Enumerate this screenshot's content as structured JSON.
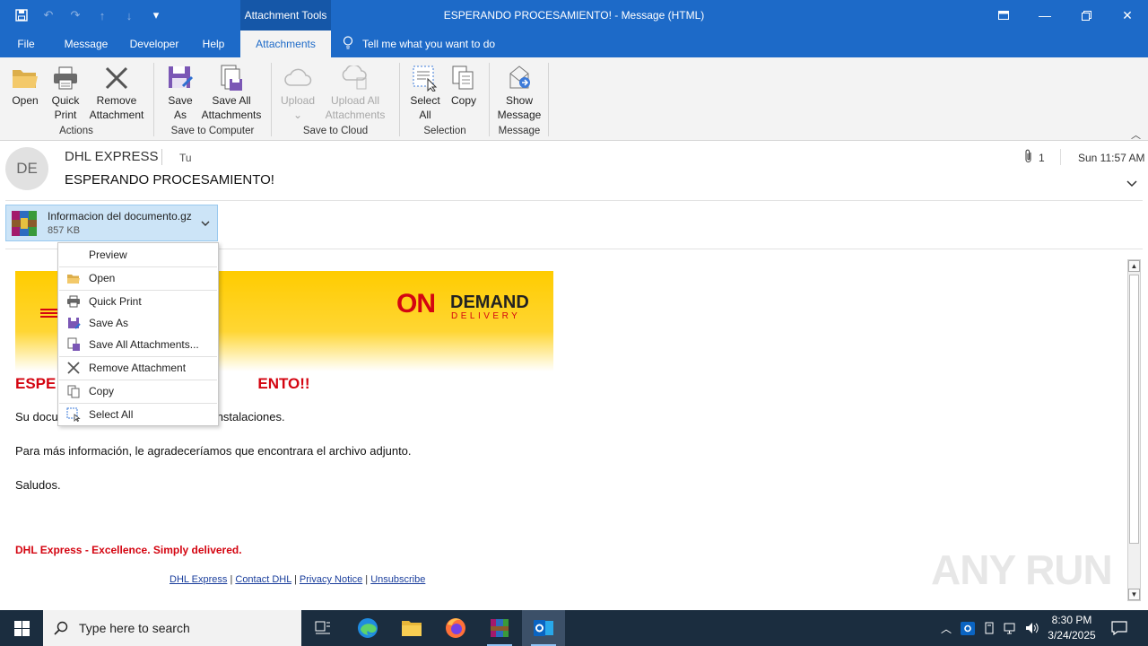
{
  "window": {
    "context_tab_group": "Attachment Tools",
    "title": "ESPERANDO PROCESAMIENTO!  -  Message (HTML)"
  },
  "tabs": [
    {
      "label": "File"
    },
    {
      "label": "Message"
    },
    {
      "label": "Developer"
    },
    {
      "label": "Help"
    },
    {
      "label": "Attachments"
    }
  ],
  "tell_me": "Tell me what you want to do",
  "ribbon": {
    "open": "Open",
    "quick_print_1": "Quick",
    "quick_print_2": "Print",
    "remove_1": "Remove",
    "remove_2": "Attachment",
    "group_actions": "Actions",
    "save_as_1": "Save",
    "save_as_2": "As",
    "save_all_1": "Save All",
    "save_all_2": "Attachments",
    "group_save": "Save to Computer",
    "upload": "Upload",
    "upload_all_1": "Upload All",
    "upload_all_2": "Attachments",
    "group_cloud": "Save to Cloud",
    "select_all_1": "Select",
    "select_all_2": "All",
    "copy": "Copy",
    "group_selection": "Selection",
    "show_msg_1": "Show",
    "show_msg_2": "Message",
    "group_message": "Message"
  },
  "message": {
    "avatar_initials": "DE",
    "sender": "DHL EXPRESS",
    "to": "Tu",
    "subject": "ESPERANDO PROCESAMIENTO!",
    "attachment_count": "1",
    "date": "Sun 11:57 AM"
  },
  "attachment": {
    "name": "Informacion del documento.gz",
    "size": "857 KB"
  },
  "context_menu": [
    {
      "label": "Preview",
      "icon": "none"
    },
    {
      "label": "Open",
      "icon": "folder-icon"
    },
    {
      "label": "Quick Print",
      "icon": "printer-icon"
    },
    {
      "label": "Save As",
      "icon": "save-icon"
    },
    {
      "label": "Save All Attachments...",
      "icon": "save-all-icon"
    },
    {
      "label": "Remove Attachment",
      "icon": "remove-icon"
    },
    {
      "label": "Copy",
      "icon": "copy-icon"
    },
    {
      "label": "Select All",
      "icon": "select-all-icon"
    }
  ],
  "email": {
    "banner_on": "ON",
    "banner_demand": "DEMAND",
    "banner_delivery": "DELIVERY",
    "headline_left": "ESPE",
    "headline_right": "ENTO!!",
    "p1_left": "Su docu",
    "p1_right": "nstalaciones.",
    "p2": "Para más información, le agradeceríamos que encontrara el archivo adjunto.",
    "p3": "Saludos.",
    "footer_tag": "DHL Express - Excellence. Simply delivered.",
    "links": [
      "DHL Express",
      "Contact DHL",
      "Privacy Notice",
      "Unsubscribe"
    ]
  },
  "watermark": "ANY RUN",
  "taskbar": {
    "search_placeholder": "Type here to search",
    "time": "8:30 PM",
    "date": "3/24/2025"
  },
  "colors": {
    "titlebar": "#1d6ac8",
    "dhl_red": "#d40511",
    "dhl_yellow": "#ffcc00",
    "taskbar": "#1b2d3f"
  }
}
